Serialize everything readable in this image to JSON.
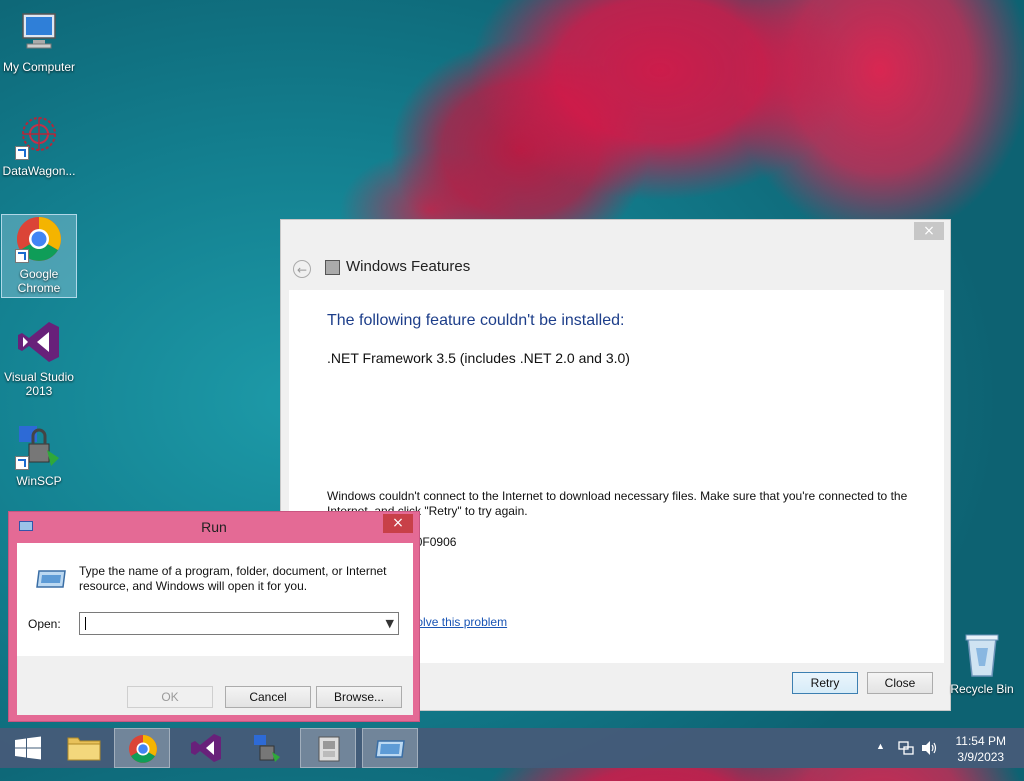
{
  "desktop": {
    "icons": [
      {
        "label": "My Computer"
      },
      {
        "label": "DataWagon..."
      },
      {
        "label": "Google Chrome"
      },
      {
        "label": "Visual Studio 2013"
      },
      {
        "label": "WinSCP"
      }
    ],
    "recycle_bin": "Recycle Bin"
  },
  "windows_features": {
    "title": "Windows Features",
    "close_glyph": "×",
    "back_glyph": "←",
    "heading": "The following feature couldn't be installed:",
    "feature": ".NET Framework 3.5 (includes .NET 2.0 and 3.0)",
    "message": "Windows couldn't connect to the Internet to download necessary files. Make sure that you're connected to the Internet, and click \"Retry\" to try again.",
    "error_code": "Error code: 0x800F0906",
    "link": "Learn how to resolve this problem",
    "buttons": {
      "retry": "Retry",
      "close": "Close"
    }
  },
  "run_dialog": {
    "title": "Run",
    "close_glyph": "×",
    "description": "Type the name of a program, folder, document, or Internet resource, and Windows will open it for you.",
    "open_label": "Open:",
    "open_value": "",
    "dropdown_glyph": "▼",
    "buttons": {
      "ok": "OK",
      "cancel": "Cancel",
      "browse": "Browse..."
    }
  },
  "taskbar": {
    "items": [
      "Start",
      "File Explorer",
      "Google Chrome",
      "Visual Studio 2013",
      "WinSCP",
      "Windows Features",
      "Run"
    ],
    "tray_arrow": "▲",
    "time": "11:54 PM",
    "date": "3/9/2023"
  },
  "colors": {
    "run_frame": "#e46a95",
    "heading_blue": "#1d3e8a",
    "link_blue": "#1a55b5",
    "taskbar": "#465a78"
  }
}
